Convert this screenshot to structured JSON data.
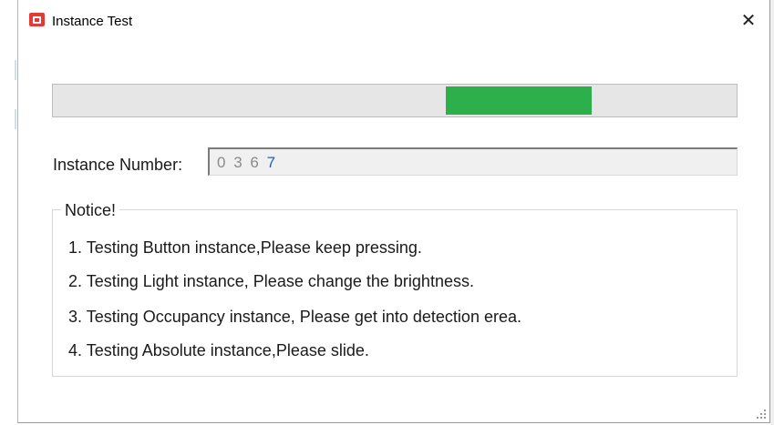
{
  "window": {
    "title": "Instance Test",
    "close_label": "✕"
  },
  "progress": {
    "fill_start_fraction": 0.575,
    "fill_fraction": 0.213,
    "color": "#2db04b"
  },
  "instance": {
    "label": "Instance Number:",
    "digits": [
      "0",
      "3",
      "6",
      "7"
    ],
    "active_index": 3
  },
  "notice": {
    "title": "Notice!",
    "items": [
      "1. Testing Button instance,Please keep pressing.",
      "2. Testing Light instance, Please change the brightness.",
      "3. Testing Occupancy instance, Please get into detection erea.",
      "4. Testing Absolute instance,Please slide."
    ]
  }
}
